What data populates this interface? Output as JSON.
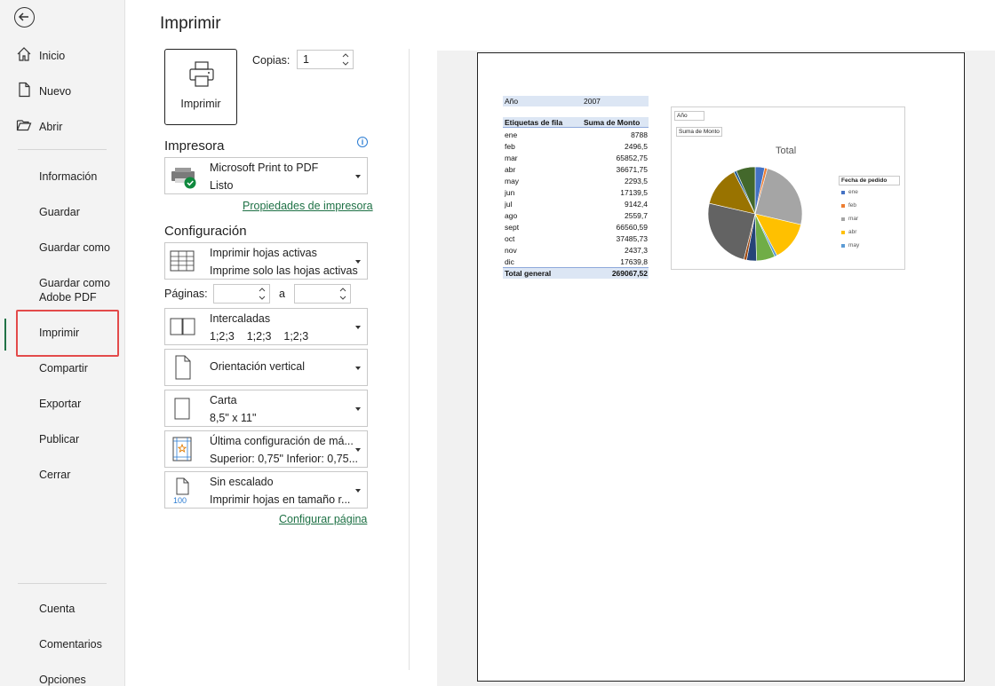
{
  "nav": {
    "items_top": [
      "Inicio",
      "Nuevo",
      "Abrir"
    ],
    "items_mid": [
      "Información",
      "Guardar",
      "Guardar como",
      "Guardar como Adobe PDF",
      "Imprimir",
      "Compartir",
      "Exportar",
      "Publicar",
      "Cerrar"
    ],
    "items_bottom": [
      "Cuenta",
      "Comentarios",
      "Opciones"
    ],
    "guardar_pdf_1": "Guardar como",
    "guardar_pdf_2": "Adobe PDF"
  },
  "main": {
    "title": "Imprimir",
    "print_button": "Imprimir",
    "copies_label": "Copias:",
    "copies_value": "1",
    "printer_section": "Impresora",
    "printer_name": "Microsoft Print to PDF",
    "printer_status": "Listo",
    "printer_props_link": "Propiedades de impresora",
    "config_section": "Configuración",
    "sheets_l1": "Imprimir hojas activas",
    "sheets_l2": "Imprime solo las hojas activas",
    "pages_label": "Páginas:",
    "pages_to": "a",
    "collate_l1": "Intercaladas",
    "collate_l2": "1;2;3    1;2;3    1;2;3",
    "orientation": "Orientación vertical",
    "paper_l1": "Carta",
    "paper_l2": "8,5\" x 11\"",
    "margins_l1": "Última configuración de má...",
    "margins_l2": "Superior: 0,75\" Inferior: 0,75...",
    "scale_l1": "Sin escalado",
    "scale_l2": "Imprimir hojas en tamaño r...",
    "scale_icon_text": "100",
    "page_setup_link": "Configurar página"
  },
  "preview": {
    "year_label": "Año",
    "year_value": "2007",
    "col1": "Etiquetas de fila",
    "col2": "Suma de Monto",
    "rows": [
      [
        "ene",
        "8788"
      ],
      [
        "feb",
        "2496,5"
      ],
      [
        "mar",
        "65852,75"
      ],
      [
        "abr",
        "36671,75"
      ],
      [
        "may",
        "2293,5"
      ],
      [
        "jun",
        "17139,5"
      ],
      [
        "jul",
        "9142,4"
      ],
      [
        "ago",
        "2559,7"
      ],
      [
        "sept",
        "66560,59"
      ],
      [
        "oct",
        "37485,73"
      ],
      [
        "nov",
        "2437,3"
      ],
      [
        "dic",
        "17639,8"
      ]
    ],
    "total_label": "Total general",
    "total_value": "269067,52"
  },
  "chart_data": {
    "type": "pie",
    "title": "Total",
    "filter_buttons": [
      "Año",
      "Suma de Monto"
    ],
    "legend_title": "Fecha de pedido",
    "legend_items": [
      "ene",
      "feb",
      "mar",
      "abr",
      "may"
    ],
    "legend_placement": "right",
    "categories": [
      "ene",
      "feb",
      "mar",
      "abr",
      "may",
      "jun",
      "jul",
      "ago",
      "sept",
      "oct",
      "nov",
      "dic"
    ],
    "values": [
      8788,
      2496.5,
      65852.75,
      36671.75,
      2293.5,
      17139.5,
      9142.4,
      2559.7,
      66560.59,
      37485.73,
      2437.3,
      17639.8
    ],
    "colors": [
      "#4472c4",
      "#ed7d31",
      "#a5a5a5",
      "#ffc000",
      "#5b9bd5",
      "#70ad47",
      "#264478",
      "#9e480e",
      "#636363",
      "#997300",
      "#255e91",
      "#43682b"
    ]
  }
}
